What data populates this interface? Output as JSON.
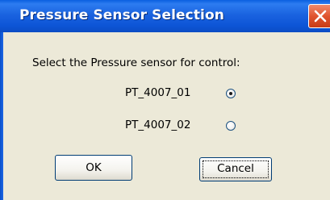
{
  "window": {
    "title": "Pressure Sensor Selection"
  },
  "dialog": {
    "prompt": "Select the Pressure sensor for control:",
    "options": [
      {
        "label": "PT_4007_01",
        "selected": true
      },
      {
        "label": "PT_4007_02",
        "selected": false
      }
    ]
  },
  "buttons": {
    "ok_label": "OK",
    "cancel_label": "Cancel"
  },
  "colors": {
    "titlebar": "#0d55d6",
    "client_background": "#ece9d8",
    "close_button": "#e0542f"
  }
}
